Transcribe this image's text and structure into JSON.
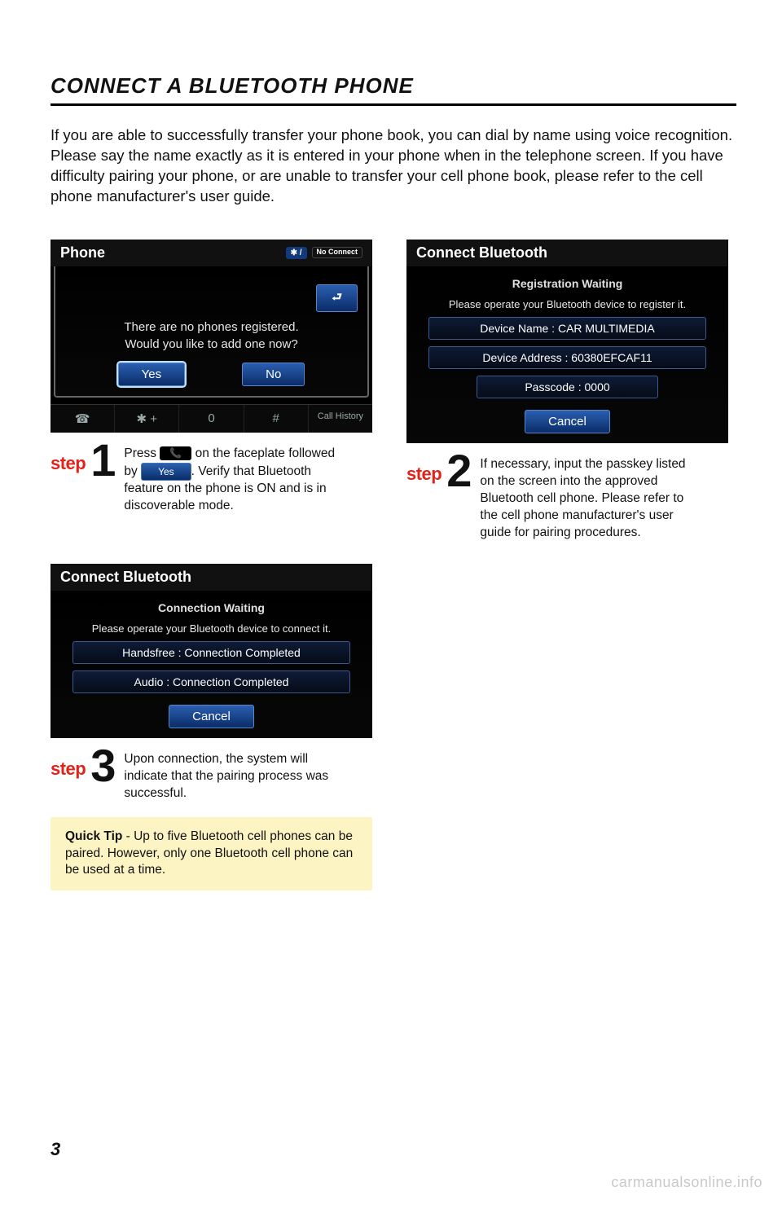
{
  "title": "CONNECT A BLUETOOTH PHONE",
  "intro": "If you are able to successfully transfer your phone book, you can dial by name using voice recognition. Please say the name exactly as it is entered in your phone when in the telephone screen. If you have difficulty pairing your phone, or are unable to transfer your cell phone book, please refer to the cell phone manufacturer's user guide.",
  "screens": {
    "s1": {
      "header": "Phone",
      "bt": "✱ /",
      "no_connect": "No Connect",
      "back": "⮐",
      "line1": "There are no phones registered.",
      "line2": "Would you like to add one now?",
      "yes": "Yes",
      "no": "No",
      "keys": {
        "k1": "☎",
        "k2": "✱ +",
        "k3": "0",
        "k4": "#",
        "k5": "Call History"
      }
    },
    "s2": {
      "header": "Connect Bluetooth",
      "sub": "Registration Waiting",
      "prompt": "Please operate your Bluetooth device to register it.",
      "dev_name": "Device Name : CAR MULTIMEDIA",
      "dev_addr": "Device Address : 60380EFCAF11",
      "passcode": "Passcode : 0000",
      "cancel": "Cancel"
    },
    "s3": {
      "header": "Connect Bluetooth",
      "sub": "Connection Waiting",
      "prompt": "Please operate your Bluetooth device to connect it.",
      "hf": "Handsfree : Connection Completed",
      "audio": "Audio : Connection Completed",
      "cancel": "Cancel"
    }
  },
  "steps": {
    "word": "step",
    "s1": {
      "n": "1",
      "t_pre": "Press ",
      "chip": "📞",
      "t_mid": " on the faceplate followed by ",
      "yes": "Yes",
      "t_post": ". Verify that Bluetooth feature on the phone is ON and is in discoverable mode."
    },
    "s2": {
      "n": "2",
      "t": "If necessary, input the passkey listed on the screen into the approved Bluetooth cell phone.  Please refer to the cell phone manufacturer's user guide for pairing procedures."
    },
    "s3": {
      "n": "3",
      "t": "Upon connection, the system will indicate that the pairing process was successful."
    }
  },
  "tip": {
    "label": "Quick Tip",
    "text": " - Up to five Bluetooth cell phones can be paired. However, only one Bluetooth cell phone can be used at a time."
  },
  "page_num": "3",
  "watermark": "carmanualsonline.info"
}
